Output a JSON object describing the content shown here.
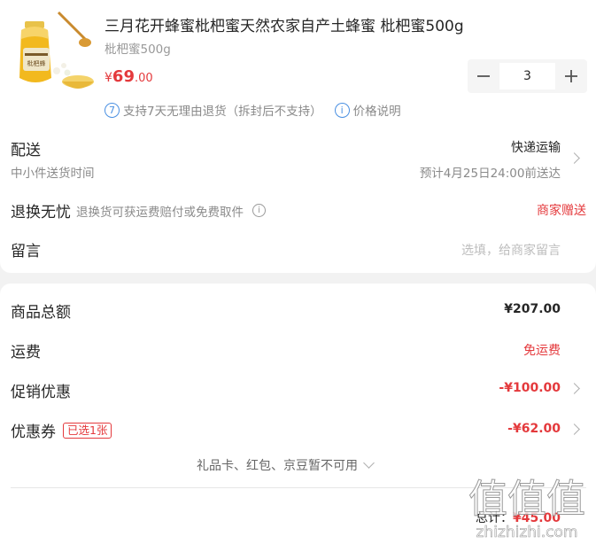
{
  "product": {
    "title": "三月花开蜂蜜枇杷蜜天然农家自产土蜂蜜 枇杷蜜500g",
    "spec": "枇杷蜜500g",
    "price_currency": "¥",
    "price_int": "69",
    "price_dec": ".00",
    "quantity": "3",
    "jar_label": "枇杷蜂"
  },
  "policy": {
    "days_badge": "7",
    "return_text": "支持7天无理由退货（拆封后不支持）",
    "info_badge": "i",
    "price_note": "价格说明"
  },
  "delivery": {
    "label": "配送",
    "method": "快递运输",
    "sub": "中小件送货时间",
    "eta": "预计4月25日24:00前送达"
  },
  "return_worry": {
    "label": "退换无忧",
    "desc": "退换货可获运费赔付或免费取件",
    "info_badge": "i",
    "value": "商家赠送"
  },
  "message": {
    "label": "留言",
    "placeholder": "选填，给商家留言"
  },
  "summary": {
    "goods_total_label": "商品总额",
    "goods_total": "¥207.00",
    "freight_label": "运费",
    "freight": "免运费",
    "promo_label": "促销优惠",
    "promo": "-¥100.00",
    "coupon_label": "优惠券",
    "coupon_badge": "已选1张",
    "coupon": "-¥62.00",
    "other_note": "礼品卡、红包、京豆暂不可用",
    "total_label": "总计：",
    "total": "¥45.00"
  },
  "watermark": {
    "glyphs": "值值值",
    "site": "zhizhizhi.com"
  },
  "colors": {
    "accent_red": "#e4393c",
    "link_blue": "#4a90e2",
    "background": "#f2f2f2"
  }
}
